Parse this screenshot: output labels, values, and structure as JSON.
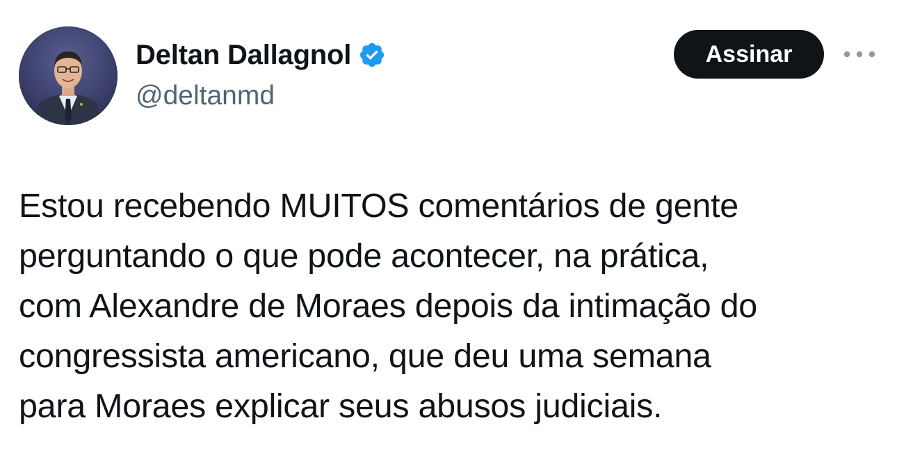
{
  "author": {
    "display_name": "Deltan Dallagnol",
    "handle": "@deltanmd",
    "verified": true,
    "verified_color": "#1d9bf0"
  },
  "actions": {
    "subscribe_label": "Assinar",
    "more_icon": "more-horizontal-icon"
  },
  "tweet": {
    "lines": [
      "Estou recebendo MUITOS comentários de gente",
      "perguntando o que pode acontecer, na prática,",
      "com Alexandre de Moraes depois da intimação do",
      "congressista americano, que deu uma semana",
      "para Moraes explicar seus abusos judiciais."
    ]
  }
}
